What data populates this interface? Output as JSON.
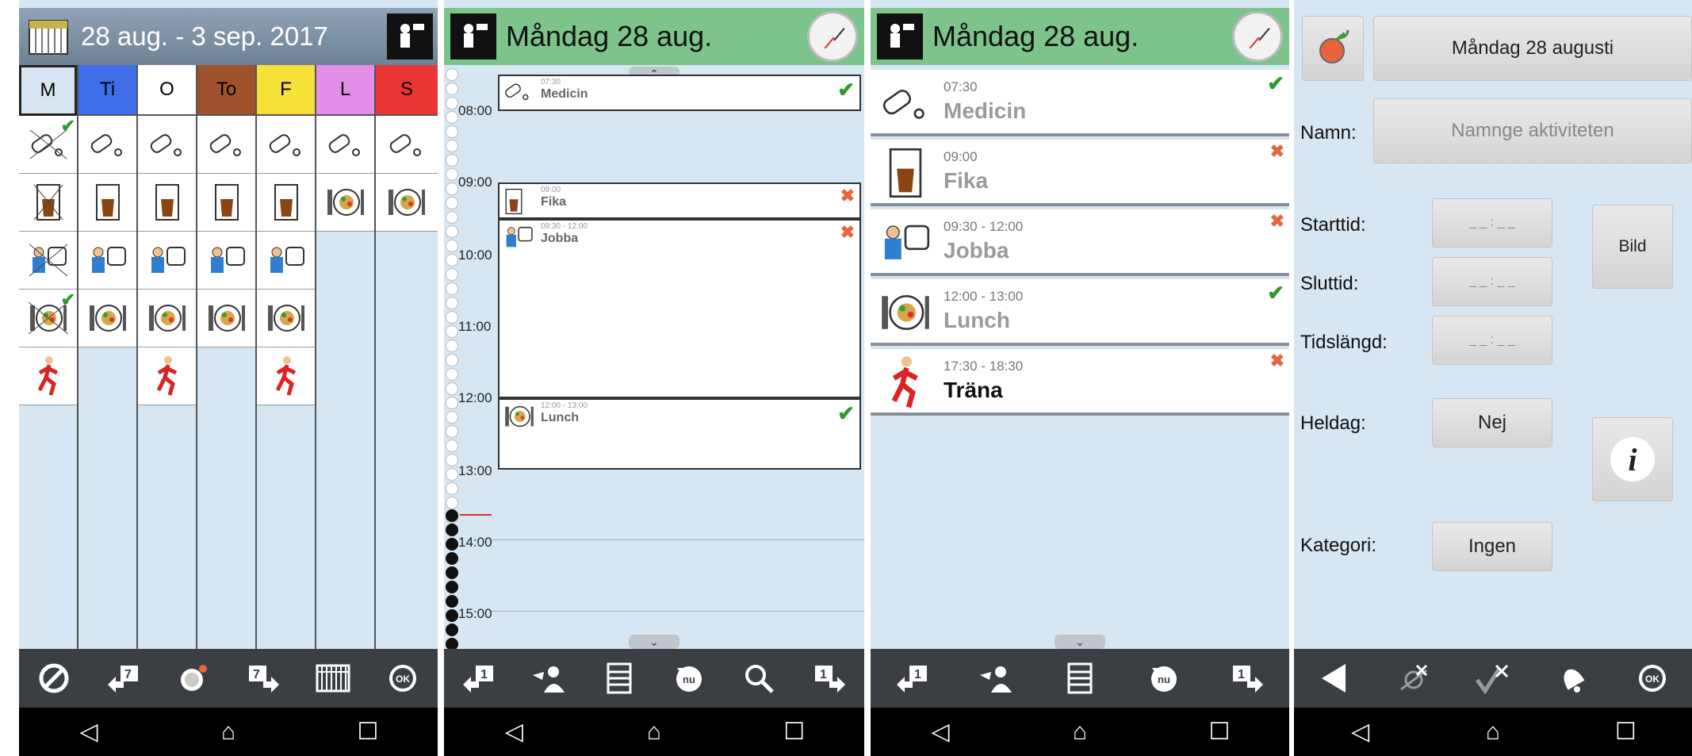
{
  "week": {
    "title": "28 aug. - 3 sep. 2017",
    "days": [
      {
        "label": "M",
        "color": "#7dc48c"
      },
      {
        "label": "Ti",
        "color": "#3f6ee8"
      },
      {
        "label": "O",
        "color": "#ffffff"
      },
      {
        "label": "To",
        "color": "#a0522d"
      },
      {
        "label": "F",
        "color": "#f5e13a"
      },
      {
        "label": "L",
        "color": "#e28de8"
      },
      {
        "label": "S",
        "color": "#ea3535"
      }
    ],
    "toolbar": [
      "no-icon",
      "prev-week-icon",
      "timer-icon",
      "next-week-icon",
      "week-grid-icon",
      "ok-icon"
    ]
  },
  "day": {
    "title": "Måndag 28 aug.",
    "hours": [
      "08:00",
      "09:00",
      "10:00",
      "11:00",
      "12:00",
      "13:00",
      "14:00",
      "15:00"
    ],
    "events": [
      {
        "time": "07:30",
        "name": "Medicin",
        "status": "done"
      },
      {
        "time": "09:00",
        "name": "Fika",
        "status": "skipped"
      },
      {
        "time": "09:30 - 12:00",
        "name": "Jobba",
        "status": "skipped"
      },
      {
        "time": "12:00 - 13:00",
        "name": "Lunch",
        "status": "done"
      }
    ]
  },
  "list": {
    "title": "Måndag 28 aug.",
    "items": [
      {
        "time": "07:30",
        "name": "Medicin",
        "status": "done"
      },
      {
        "time": "09:00",
        "name": "Fika",
        "status": "skipped"
      },
      {
        "time": "09:30 - 12:00",
        "name": "Jobba",
        "status": "skipped"
      },
      {
        "time": "12:00 - 13:00",
        "name": "Lunch",
        "status": "done"
      },
      {
        "time": "17:30 - 18:30",
        "name": "Träna",
        "status": "skipped"
      }
    ]
  },
  "edit": {
    "date_label": "Måndag 28 augusti",
    "name_label": "Namn:",
    "name_placeholder": "Namnge aktiviteten",
    "start_label": "Starttid:",
    "end_label": "Sluttid:",
    "duration_label": "Tidslängd:",
    "time_placeholder": "_ _ : _ _",
    "image_button": "Bild",
    "allday_label": "Heldag:",
    "allday_value": "Nej",
    "category_label": "Kategori:",
    "category_value": "Ingen",
    "info_icon": "i"
  },
  "nav_icons": [
    "back-icon",
    "home-icon",
    "recents-icon"
  ],
  "nu_label": "nu",
  "ok_label": "OK"
}
